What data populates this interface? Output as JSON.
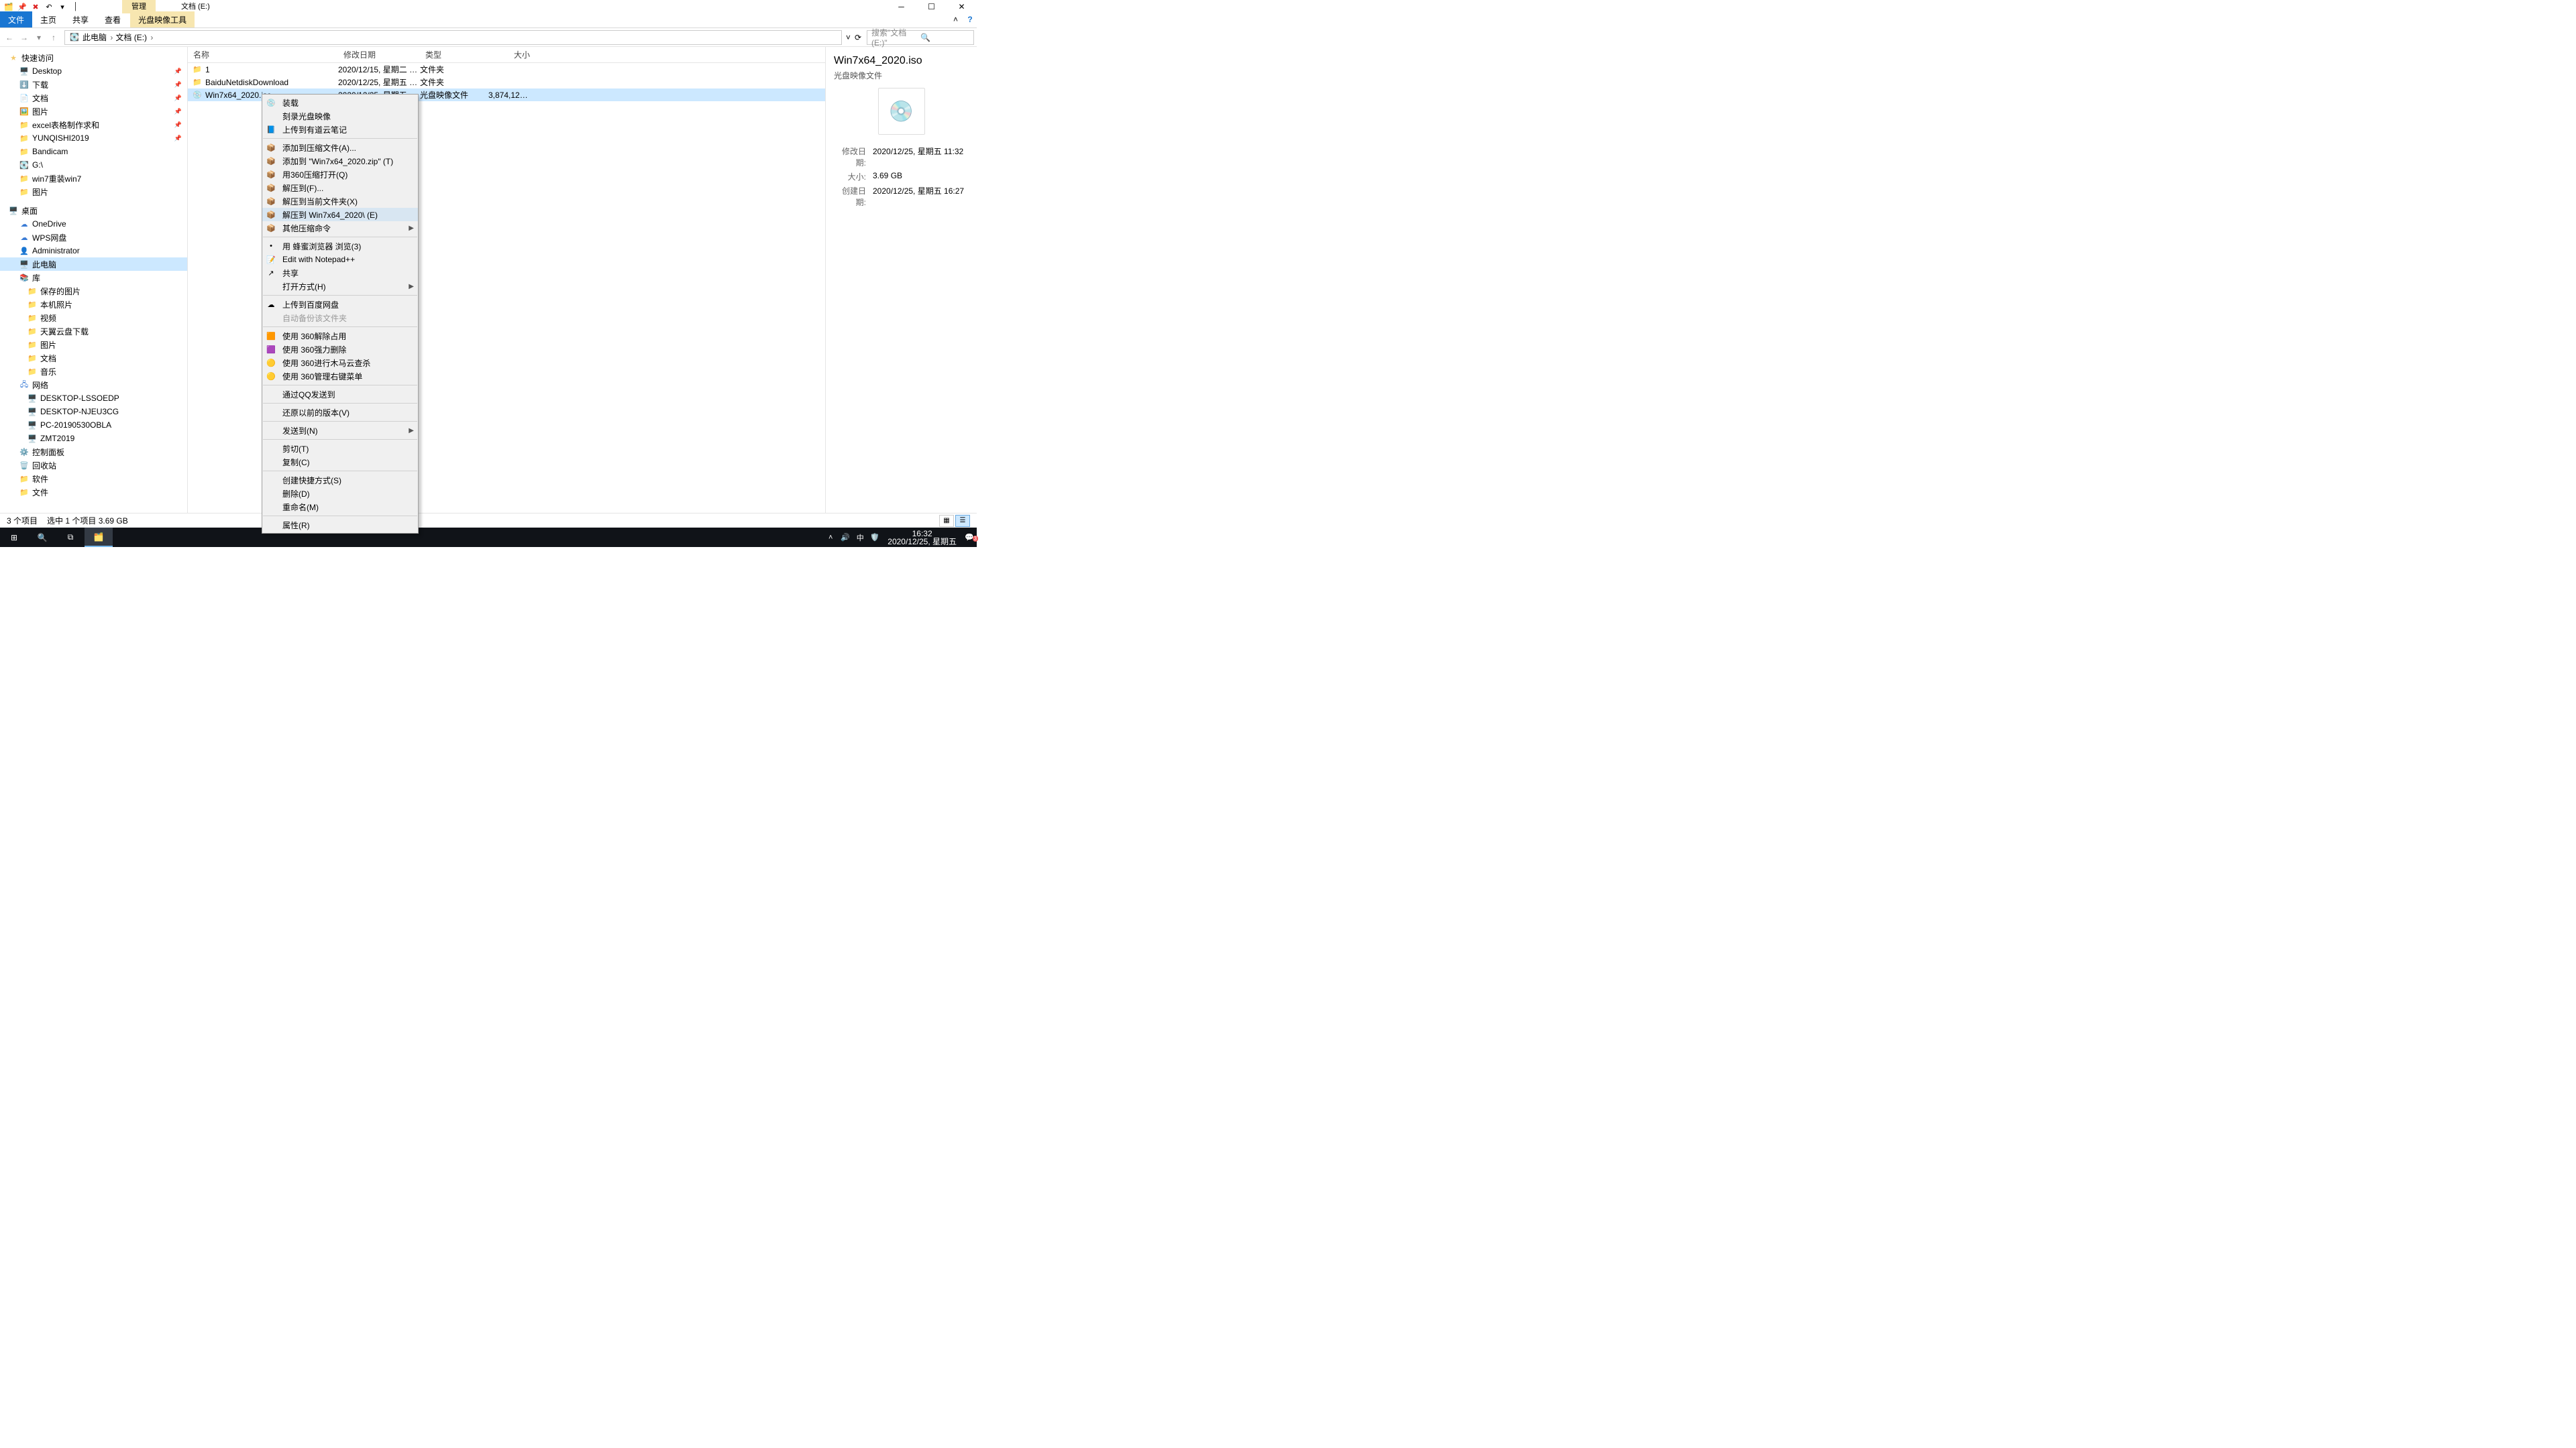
{
  "titlebar": {
    "context_tab": "管理",
    "window_title": "文档 (E:)"
  },
  "ribbon": {
    "file": "文件",
    "home": "主页",
    "share": "共享",
    "view": "查看",
    "disc": "光盘映像工具"
  },
  "nav": {
    "crumbs": [
      "此电脑",
      "文档 (E:)"
    ],
    "search_placeholder": "搜索\"文档 (E:)\""
  },
  "tree": {
    "quick": "快速访问",
    "quick_items": [
      "Desktop",
      "下载",
      "文档",
      "图片",
      "excel表格制作求和",
      "YUNQISHI2019",
      "Bandicam",
      "G:\\",
      "win7重装win7",
      "图片"
    ],
    "desktop": "桌面",
    "desktop_items": [
      "OneDrive",
      "WPS网盘",
      "Administrator",
      "此电脑",
      "库"
    ],
    "lib_items": [
      "保存的图片",
      "本机照片",
      "视频",
      "天翼云盘下载",
      "图片",
      "文档",
      "音乐"
    ],
    "network": "网络",
    "net_items": [
      "DESKTOP-LSSOEDP",
      "DESKTOP-NJEU3CG",
      "PC-20190530OBLA",
      "ZMT2019"
    ],
    "other": [
      "控制面板",
      "回收站",
      "软件",
      "文件"
    ]
  },
  "columns": {
    "name": "名称",
    "date": "修改日期",
    "type": "类型",
    "size": "大小"
  },
  "rows": [
    {
      "name": "1",
      "date": "2020/12/15, 星期二 1...",
      "type": "文件夹",
      "size": "",
      "icon": "folder"
    },
    {
      "name": "BaiduNetdiskDownload",
      "date": "2020/12/25, 星期五 1...",
      "type": "文件夹",
      "size": "",
      "icon": "folder"
    },
    {
      "name": "Win7x64_2020.iso",
      "date": "2020/12/25, 星期五 1...",
      "type": "光盘映像文件",
      "size": "3,874,126...",
      "icon": "disc",
      "selected": true
    }
  ],
  "details": {
    "title": "Win7x64_2020.iso",
    "type": "光盘映像文件",
    "k_modified": "修改日期:",
    "v_modified": "2020/12/25, 星期五 11:32",
    "k_size": "大小:",
    "v_size": "3.69 GB",
    "k_created": "创建日期:",
    "v_created": "2020/12/25, 星期五 16:27"
  },
  "status": {
    "items": "3 个项目",
    "sel": "选中 1 个项目  3.69 GB"
  },
  "ctx": [
    {
      "t": "装载",
      "ic": "💿"
    },
    {
      "t": "刻录光盘映像"
    },
    {
      "t": "上传到有道云笔记",
      "ic": "📘"
    },
    {
      "sep": true
    },
    {
      "t": "添加到压缩文件(A)...",
      "ic": "📦"
    },
    {
      "t": "添加到 \"Win7x64_2020.zip\" (T)",
      "ic": "📦"
    },
    {
      "t": "用360压缩打开(Q)",
      "ic": "📦"
    },
    {
      "t": "解压到(F)...",
      "ic": "📦"
    },
    {
      "t": "解压到当前文件夹(X)",
      "ic": "📦"
    },
    {
      "t": "解压到 Win7x64_2020\\ (E)",
      "ic": "📦",
      "hov": true
    },
    {
      "t": "其他压缩命令",
      "ic": "📦",
      "sub": true
    },
    {
      "sep": true
    },
    {
      "t": "用 蜂蜜浏览器 浏览(3)",
      "ic": "•"
    },
    {
      "t": "Edit with Notepad++",
      "ic": "📝"
    },
    {
      "t": "共享",
      "ic": "↗"
    },
    {
      "t": "打开方式(H)",
      "sub": true
    },
    {
      "sep": true
    },
    {
      "t": "上传到百度网盘",
      "ic": "☁"
    },
    {
      "t": "自动备份该文件夹",
      "dis": true
    },
    {
      "sep": true
    },
    {
      "t": "使用 360解除占用",
      "ic": "🟧"
    },
    {
      "t": "使用 360强力删除",
      "ic": "🟪"
    },
    {
      "t": "使用 360进行木马云查杀",
      "ic": "🟡"
    },
    {
      "t": "使用 360管理右键菜单",
      "ic": "🟡"
    },
    {
      "sep": true
    },
    {
      "t": "通过QQ发送到"
    },
    {
      "sep": true
    },
    {
      "t": "还原以前的版本(V)"
    },
    {
      "sep": true
    },
    {
      "t": "发送到(N)",
      "sub": true
    },
    {
      "sep": true
    },
    {
      "t": "剪切(T)"
    },
    {
      "t": "复制(C)"
    },
    {
      "sep": true
    },
    {
      "t": "创建快捷方式(S)"
    },
    {
      "t": "删除(D)"
    },
    {
      "t": "重命名(M)"
    },
    {
      "sep": true
    },
    {
      "t": "属性(R)"
    }
  ],
  "taskbar": {
    "time": "16:32",
    "date": "2020/12/25, 星期五",
    "ime": "中",
    "badge": "3"
  }
}
